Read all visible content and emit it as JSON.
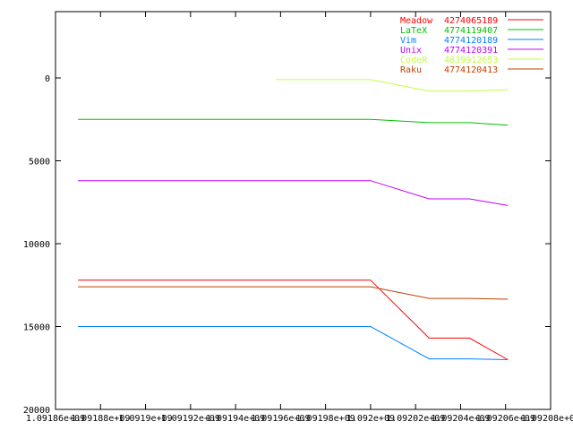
{
  "chart_data": {
    "type": "line",
    "title": "",
    "xlabel": "",
    "ylabel": "",
    "y_inverted": true,
    "ylim": [
      -4000,
      20000
    ],
    "xlim": [
      1.09186,
      1.09208
    ],
    "grid": false,
    "legend_position": "top-right",
    "y_ticks": [
      {
        "value": 0,
        "label": "0"
      },
      {
        "value": 5000,
        "label": "5000"
      },
      {
        "value": 10000,
        "label": "10000"
      },
      {
        "value": 15000,
        "label": "15000"
      },
      {
        "value": 20000,
        "label": "20000"
      }
    ],
    "x_ticks": [
      {
        "value": 1.09186,
        "label": "1.09186e+09"
      },
      {
        "value": 1.09188,
        "label": "1.09188e+09"
      },
      {
        "value": 1.0919,
        "label": "1.0919e+09"
      },
      {
        "value": 1.09192,
        "label": "1.09192e+09"
      },
      {
        "value": 1.09194,
        "label": "1.09194e+09"
      },
      {
        "value": 1.09196,
        "label": "1.09196e+09"
      },
      {
        "value": 1.09198,
        "label": "1.09198e+09"
      },
      {
        "value": 1.092,
        "label": "1.092e+09"
      },
      {
        "value": 1.09202,
        "label": "1.09202e+09"
      },
      {
        "value": 1.09204,
        "label": "1.09204e+09"
      },
      {
        "value": 1.09206,
        "label": "1.09206e+09"
      },
      {
        "value": 1.09208,
        "label": "1.09208e+09"
      }
    ],
    "series": [
      {
        "name": "Meadow",
        "id": "4274065189",
        "color": "#ff0000",
        "x": [
          1.09187,
          1.092,
          1.092026,
          1.092044,
          1.092061
        ],
        "y": [
          12200,
          12200,
          15700,
          15700,
          17000
        ]
      },
      {
        "name": "LaTeX",
        "id": "4774119407",
        "color": "#00c000",
        "x": [
          1.09187,
          1.092,
          1.092026,
          1.092044,
          1.092061
        ],
        "y": [
          2500,
          2500,
          2700,
          2700,
          2850
        ]
      },
      {
        "name": "Vim",
        "id": "4774120189",
        "color": "#0080ff",
        "x": [
          1.09187,
          1.092,
          1.092026,
          1.092044,
          1.092061
        ],
        "y": [
          15000,
          15000,
          16950,
          16950,
          17000
        ]
      },
      {
        "name": "Unix",
        "id": "4774120391",
        "color": "#c000ff",
        "x": [
          1.09187,
          1.092,
          1.092026,
          1.092044,
          1.092061
        ],
        "y": [
          6200,
          6200,
          7300,
          7300,
          7700
        ]
      },
      {
        "name": "CodeR",
        "id": "4839912653",
        "color": "#c0ff40",
        "x": [
          1.091958,
          1.092,
          1.092026,
          1.092044,
          1.092061
        ],
        "y": [
          100,
          100,
          800,
          800,
          700
        ]
      },
      {
        "name": "Raku",
        "id": "4774120413",
        "color": "#c04000",
        "x": [
          1.09187,
          1.092,
          1.092026,
          1.092044,
          1.092061
        ],
        "y": [
          12600,
          12600,
          13300,
          13300,
          13350
        ]
      }
    ]
  }
}
